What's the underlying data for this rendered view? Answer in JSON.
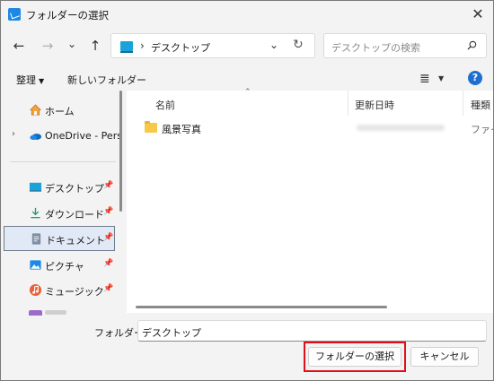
{
  "window": {
    "title": "フォルダーの選択"
  },
  "nav": {
    "back": "←",
    "forward": "→",
    "recent": "⌄",
    "up": "↑",
    "address": "デスクトップ",
    "search_placeholder": "デスクトップの検索"
  },
  "commands": {
    "organize": "整理",
    "new_folder": "新しいフォルダー",
    "help": "?"
  },
  "sidebar": {
    "items": [
      {
        "label": "ホーム",
        "icon": "home-icon"
      },
      {
        "label": "OneDrive - Pers",
        "icon": "onedrive-icon"
      },
      {
        "label": "デスクトップ",
        "icon": "desktop-icon",
        "pinned": true
      },
      {
        "label": "ダウンロード",
        "icon": "download-icon",
        "pinned": true
      },
      {
        "label": "ドキュメント",
        "icon": "documents-icon",
        "pinned": true,
        "selected": true
      },
      {
        "label": "ピクチャ",
        "icon": "pictures-icon",
        "pinned": true
      },
      {
        "label": "ミュージック",
        "icon": "music-icon",
        "pinned": true
      }
    ]
  },
  "columns": {
    "name": "名前",
    "modified": "更新日時",
    "type": "種類"
  },
  "files": [
    {
      "name": "風景写真",
      "type": "ファイル"
    }
  ],
  "footer": {
    "folder_label": "フォルダー:",
    "folder_value": "デスクトップ",
    "select_button": "フォルダーの選択",
    "cancel_button": "キャンセル"
  },
  "colors": {
    "accent": "#1e6fd0",
    "highlight": "#e0101a",
    "folder": "#f7c948"
  }
}
